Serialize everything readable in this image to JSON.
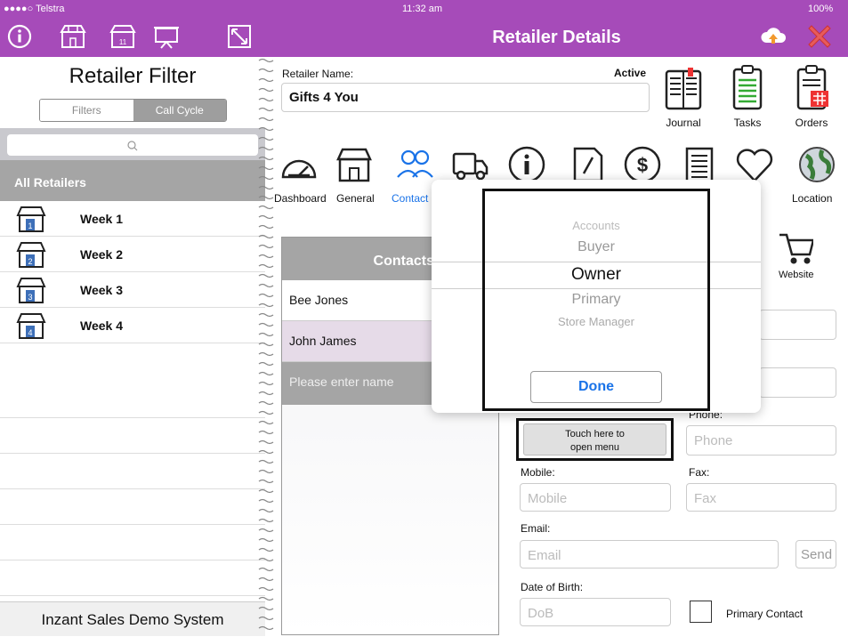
{
  "status": {
    "carrier": "●●●●○ Telstra",
    "time": "11:32 am",
    "battery": "100%"
  },
  "nav": {
    "title": "Retailer Details"
  },
  "left": {
    "title": "Retailer Filter",
    "seg_filters": "Filters",
    "seg_callcycle": "Call Cycle",
    "all_retailers": "All Retailers",
    "weeks": [
      "Week 1",
      "Week 2",
      "Week 3",
      "Week 4"
    ],
    "footer": "Inzant Sales Demo System"
  },
  "retailer": {
    "name_label": "Retailer Name:",
    "name": "Gifts 4 You",
    "status": "Active"
  },
  "top_icons": {
    "journal": "Journal",
    "tasks": "Tasks",
    "orders": "Orders"
  },
  "tabs": {
    "dashboard": "Dashboard",
    "general": "General",
    "contact": "Contact",
    "loyalty": "lty",
    "location": "Location",
    "website": "Website"
  },
  "contacts": {
    "header": "Contacts",
    "items": [
      "Bee Jones",
      "John James"
    ],
    "placeholder": "Please enter name"
  },
  "picker": {
    "options": [
      "Accounts",
      "Buyer",
      "Owner",
      "Primary",
      "Store Manager"
    ],
    "selected": "Owner",
    "done": "Done"
  },
  "form": {
    "contact_type_btn": "Touch here to open menu",
    "phone_label": "Phone:",
    "phone_ph": "Phone",
    "mobile_label": "Mobile:",
    "mobile_ph": "Mobile",
    "fax_label": "Fax:",
    "fax_ph": "Fax",
    "email_label": "Email:",
    "email_ph": "Email",
    "send": "Send",
    "dob_label": "Date of Birth:",
    "dob_ph": "DoB",
    "primary_contact": "Primary Contact"
  },
  "colors": {
    "accent": "#a64bb9",
    "link": "#1a73e8"
  }
}
